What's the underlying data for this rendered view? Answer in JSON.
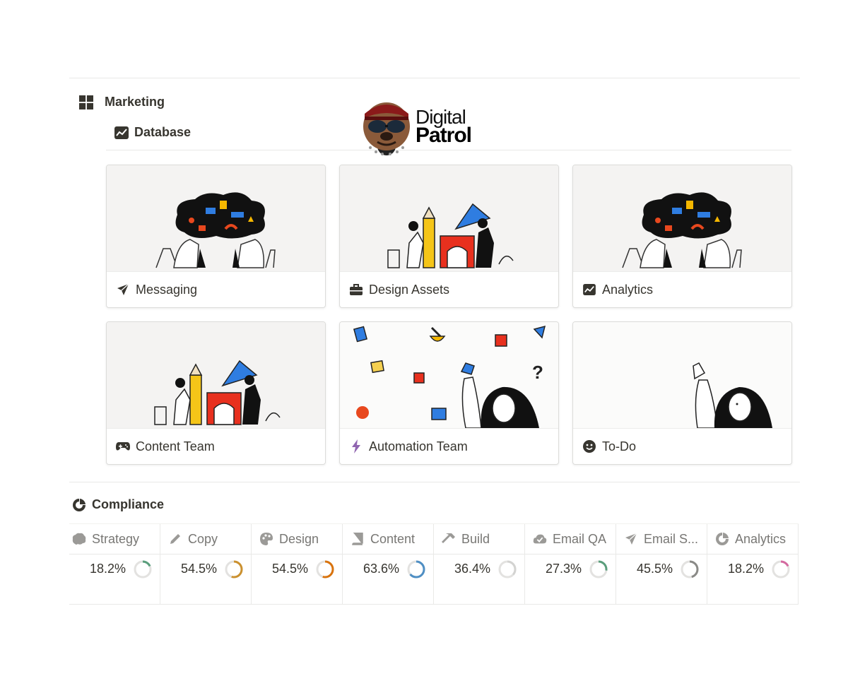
{
  "sections": {
    "marketing": {
      "title": "Marketing",
      "icon": "grid-icon"
    },
    "database": {
      "title": "Database",
      "icon": "chart-line-icon"
    },
    "compliance": {
      "title": "Compliance",
      "icon": "pie-chart-icon"
    }
  },
  "logo": {
    "line1": "Digital",
    "line2": "Patrol"
  },
  "cards": [
    {
      "title": "Messaging",
      "icon": "paper-plane-icon"
    },
    {
      "title": "Design Assets",
      "icon": "briefcase-icon"
    },
    {
      "title": "Analytics",
      "icon": "chart-line-icon"
    },
    {
      "title": "Content Team",
      "icon": "gamepad-icon"
    },
    {
      "title": "Automation Team",
      "icon": "lightning-icon"
    },
    {
      "title": "To-Do",
      "icon": "smiley-icon"
    }
  ],
  "compliance_table": {
    "columns": [
      {
        "label": "Strategy",
        "icon": "brain-icon",
        "value": "18.2%",
        "fraction": 0.182,
        "color": "#5a9e7c"
      },
      {
        "label": "Copy",
        "icon": "pencil-icon",
        "value": "54.5%",
        "fraction": 0.545,
        "color": "#cb912f"
      },
      {
        "label": "Design",
        "icon": "palette-icon",
        "value": "54.5%",
        "fraction": 0.545,
        "color": "#d9730d"
      },
      {
        "label": "Content",
        "icon": "book-icon",
        "value": "63.6%",
        "fraction": 0.636,
        "color": "#4f8fc4"
      },
      {
        "label": "Build",
        "icon": "hammer-icon",
        "value": "36.4%",
        "fraction": 0.364,
        "color": "#d3d3d1"
      },
      {
        "label": "Email QA",
        "icon": "cloud-check-icon",
        "value": "27.3%",
        "fraction": 0.273,
        "color": "#5a9e7c"
      },
      {
        "label": "Email S...",
        "icon": "paper-plane-icon",
        "value": "45.5%",
        "fraction": 0.455,
        "color": "#8a8a87"
      },
      {
        "label": "Analytics",
        "icon": "pie-chart-icon",
        "value": "18.2%",
        "fraction": 0.182,
        "color": "#d46aa0"
      }
    ]
  }
}
